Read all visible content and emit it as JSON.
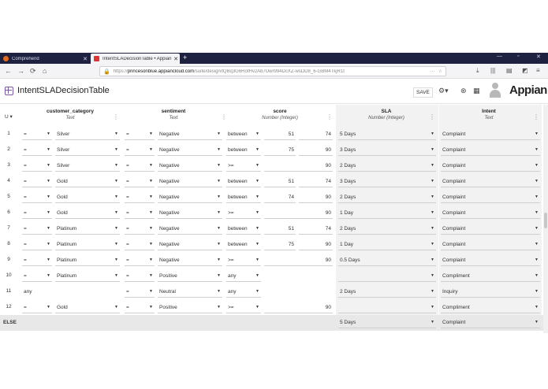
{
  "browser": {
    "tabs": [
      {
        "label": "Comprehend",
        "close": "✕"
      },
      {
        "label": "IntentSLADecisionTable • Appian",
        "close": "✕"
      }
    ],
    "new_tab": "+",
    "url_prefix": "https://",
    "url_host": "princesonblue.appiancloud.com",
    "url_path": "/suite/design/lQBq3G6RotHv2Ab7Dwr994DcXZ-wsDD8_6-GBM4TkjR1t",
    "window_controls": [
      "—",
      "▫",
      "✕"
    ]
  },
  "app": {
    "title": "IntentSLADecisionTable",
    "save_label": "SAVE",
    "brand": "Appian"
  },
  "table": {
    "hit_policy": "U",
    "columns": [
      {
        "name": "customer_category",
        "type": "Text"
      },
      {
        "name": "sentiment",
        "type": "Text"
      },
      {
        "name": "score",
        "type": "Number (Integer)"
      },
      {
        "name": "SLA",
        "type": "Number (Integer)"
      },
      {
        "name": "Intent",
        "type": "Text"
      }
    ],
    "rows": [
      {
        "n": "1",
        "cat_op": "=",
        "cat": "Silver",
        "sent_op": "=",
        "sent": "Negative",
        "score_op": "between",
        "lo": "51",
        "hi": "74",
        "sla": "5 Days",
        "intent": "Complaint"
      },
      {
        "n": "2",
        "cat_op": "=",
        "cat": "Silver",
        "sent_op": "=",
        "sent": "Negative",
        "score_op": "between",
        "lo": "75",
        "hi": "90",
        "sla": "3 Days",
        "intent": "Complaint"
      },
      {
        "n": "3",
        "cat_op": "=",
        "cat": "Silver",
        "sent_op": "=",
        "sent": "Negative",
        "score_op": ">=",
        "lo": "",
        "hi": "90",
        "sla": "2 Days",
        "intent": "Complaint"
      },
      {
        "n": "4",
        "cat_op": "=",
        "cat": "Gold",
        "sent_op": "=",
        "sent": "Negative",
        "score_op": "between",
        "lo": "51",
        "hi": "74",
        "sla": "3 Days",
        "intent": "Complaint"
      },
      {
        "n": "5",
        "cat_op": "=",
        "cat": "Gold",
        "sent_op": "=",
        "sent": "Negative",
        "score_op": "between",
        "lo": "74",
        "hi": "90",
        "sla": "2 Days",
        "intent": "Complaint"
      },
      {
        "n": "6",
        "cat_op": "=",
        "cat": "Gold",
        "sent_op": "=",
        "sent": "Negative",
        "score_op": ">=",
        "lo": "",
        "hi": "90",
        "sla": "1 Day",
        "intent": "Complaint"
      },
      {
        "n": "7",
        "cat_op": "=",
        "cat": "Platinum",
        "sent_op": "=",
        "sent": "Negative",
        "score_op": "between",
        "lo": "51",
        "hi": "74",
        "sla": "2 Days",
        "intent": "Complaint"
      },
      {
        "n": "8",
        "cat_op": "=",
        "cat": "Platinum",
        "sent_op": "=",
        "sent": "Negative",
        "score_op": "between",
        "lo": "75",
        "hi": "90",
        "sla": "1 Day",
        "intent": "Complaint"
      },
      {
        "n": "9",
        "cat_op": "=",
        "cat": "Platinum",
        "sent_op": "=",
        "sent": "Negative",
        "score_op": ">=",
        "lo": "",
        "hi": "90",
        "sla": "0.5 Days",
        "intent": "Complaint"
      },
      {
        "n": "10",
        "cat_op": "=",
        "cat": "Platinum",
        "sent_op": "=",
        "sent": "Positive",
        "score_op": "any",
        "lo": "",
        "hi": "",
        "sla": "",
        "intent": "Compliment"
      },
      {
        "n": "11",
        "cat_op": "any",
        "cat": "",
        "sent_op": "=",
        "sent": "Neutral",
        "score_op": "any",
        "lo": "",
        "hi": "",
        "sla": "2 Days",
        "intent": "Inquiry"
      },
      {
        "n": "12",
        "cat_op": "=",
        "cat": "Gold",
        "sent_op": "=",
        "sent": "Positive",
        "score_op": ">=",
        "lo": "",
        "hi": "90",
        "sla": "",
        "intent": "Compliment"
      }
    ],
    "else": {
      "label": "ELSE",
      "sla": "5 Days",
      "intent": "Complaint"
    }
  },
  "colors": {
    "tabbar": "#1e2240",
    "accent": "#7a58a8"
  }
}
